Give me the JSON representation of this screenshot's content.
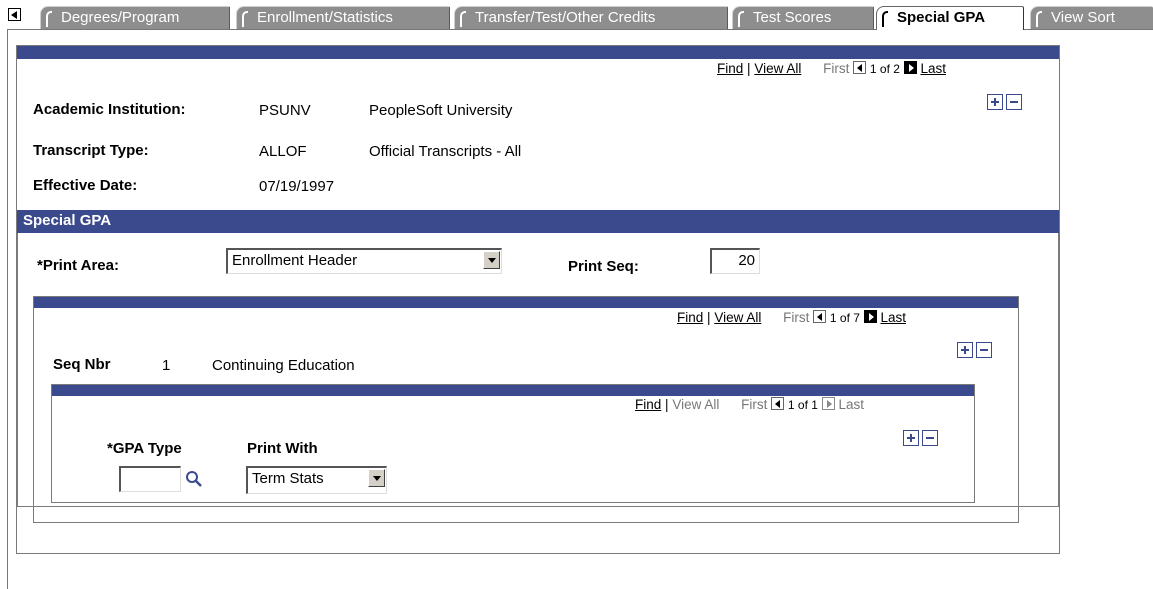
{
  "tabs": [
    {
      "label": "Degrees/Program",
      "active": false
    },
    {
      "label": "Enrollment/Statistics",
      "active": false
    },
    {
      "label": "Transfer/Test/Other Credits",
      "active": false
    },
    {
      "label": "Test Scores",
      "active": false
    },
    {
      "label": "Special GPA",
      "active": true
    },
    {
      "label": "View Sort",
      "active": false
    }
  ],
  "outer_nav": {
    "find": "Find",
    "sep": "|",
    "view_all": "View All",
    "first": "First",
    "position": "1 of 2",
    "last": "Last"
  },
  "header": {
    "institution_label": "Academic Institution:",
    "institution_code": "PSUNV",
    "institution_name": "PeopleSoft University",
    "transcript_label": "Transcript Type:",
    "transcript_code": "ALLOF",
    "transcript_name": "Official Transcripts - All",
    "effdate_label": "Effective Date:",
    "effdate_value": "07/19/1997"
  },
  "special_gpa": {
    "title": "Special GPA",
    "print_area_label": "*Print Area:",
    "print_area_value": "Enrollment Header",
    "print_seq_label": "Print Seq:",
    "print_seq_value": "20"
  },
  "seq_nav": {
    "find": "Find",
    "sep": "|",
    "view_all": "View All",
    "first": "First",
    "position": "1 of 7",
    "last": "Last"
  },
  "seq": {
    "label": "Seq Nbr",
    "number": "1",
    "description": "Continuing Education"
  },
  "gpa_nav": {
    "find": "Find",
    "sep": "|",
    "view_all": "View All",
    "first": "First",
    "position": "1 of 1",
    "last": "Last"
  },
  "gpa": {
    "type_label": "*GPA Type",
    "type_value": "",
    "print_with_label": "Print With",
    "print_with_value": "Term Stats"
  },
  "colors": {
    "bar": "#3b4a8c",
    "tab_inactive": "#8e8e8e"
  }
}
